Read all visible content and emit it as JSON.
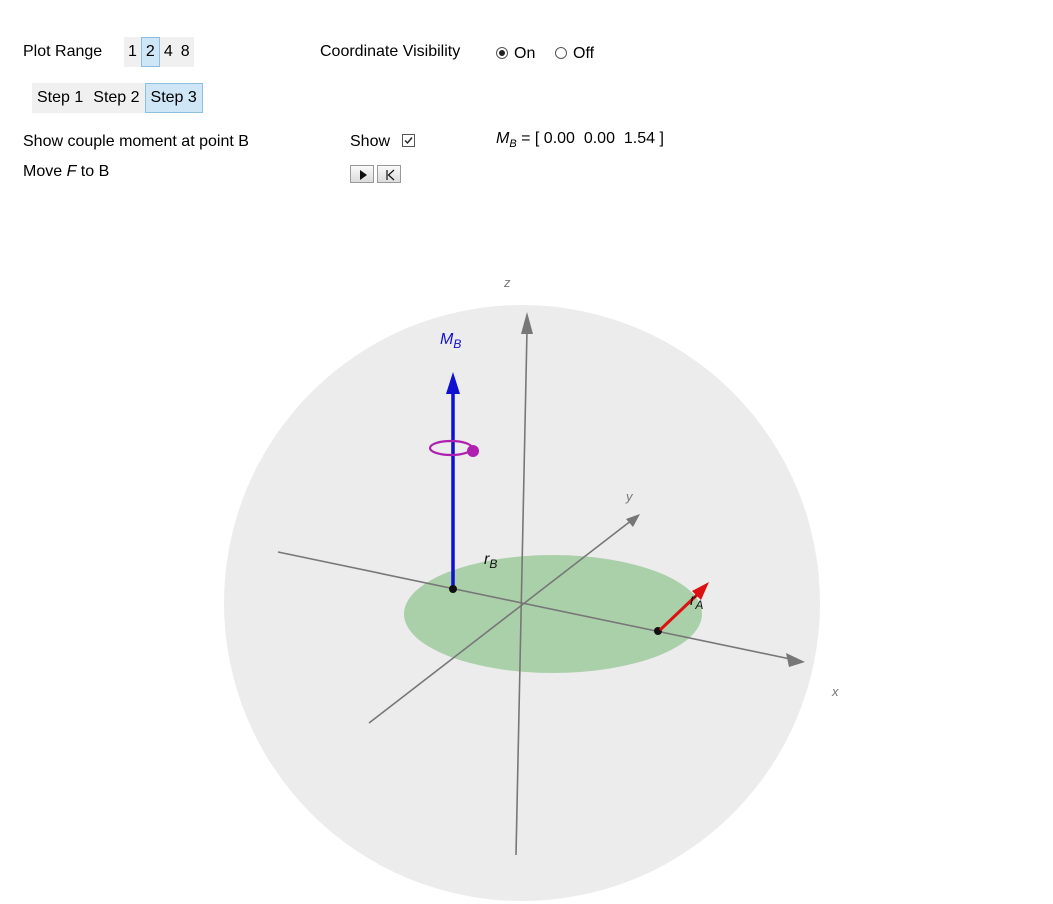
{
  "controls": {
    "plot_range": {
      "label": "Plot Range",
      "options": [
        "1",
        "2",
        "4",
        "8"
      ],
      "selected": "2"
    },
    "coordinate_visibility": {
      "label": "Coordinate Visibility",
      "on_label": "On",
      "off_label": "Off",
      "selected": "On"
    },
    "steps": {
      "options": [
        "Step 1",
        "Step 2",
        "Step 3"
      ],
      "selected": "Step 3"
    },
    "couple_moment": {
      "label": "Show couple moment at point B",
      "show_label": "Show",
      "checked": true
    },
    "moment_readout": {
      "symbol": "M",
      "subscript": "B",
      "text": "= [ 0.00  0.00  1.54 ]"
    },
    "move_force": {
      "label_prefix": "Move ",
      "label_var": "F",
      "label_suffix": " to B",
      "play_icon": "play-icon",
      "reset_icon": "reset-to-start-icon"
    }
  },
  "scene": {
    "axis_x": "x",
    "axis_y": "y",
    "axis_z": "z",
    "moment_label": {
      "symbol": "M",
      "subscript": "B"
    },
    "rb_label": {
      "symbol": "r",
      "subscript": "B"
    },
    "ra_label": {
      "symbol": "r",
      "subscript": "A"
    },
    "colors": {
      "sphere": "#ececec",
      "disk": "#a6cfa6",
      "axes": "#777777",
      "moment_arrow": "#1010d0",
      "position_arrow": "#dd1111",
      "rotation_indicator": "#b020b0"
    }
  }
}
